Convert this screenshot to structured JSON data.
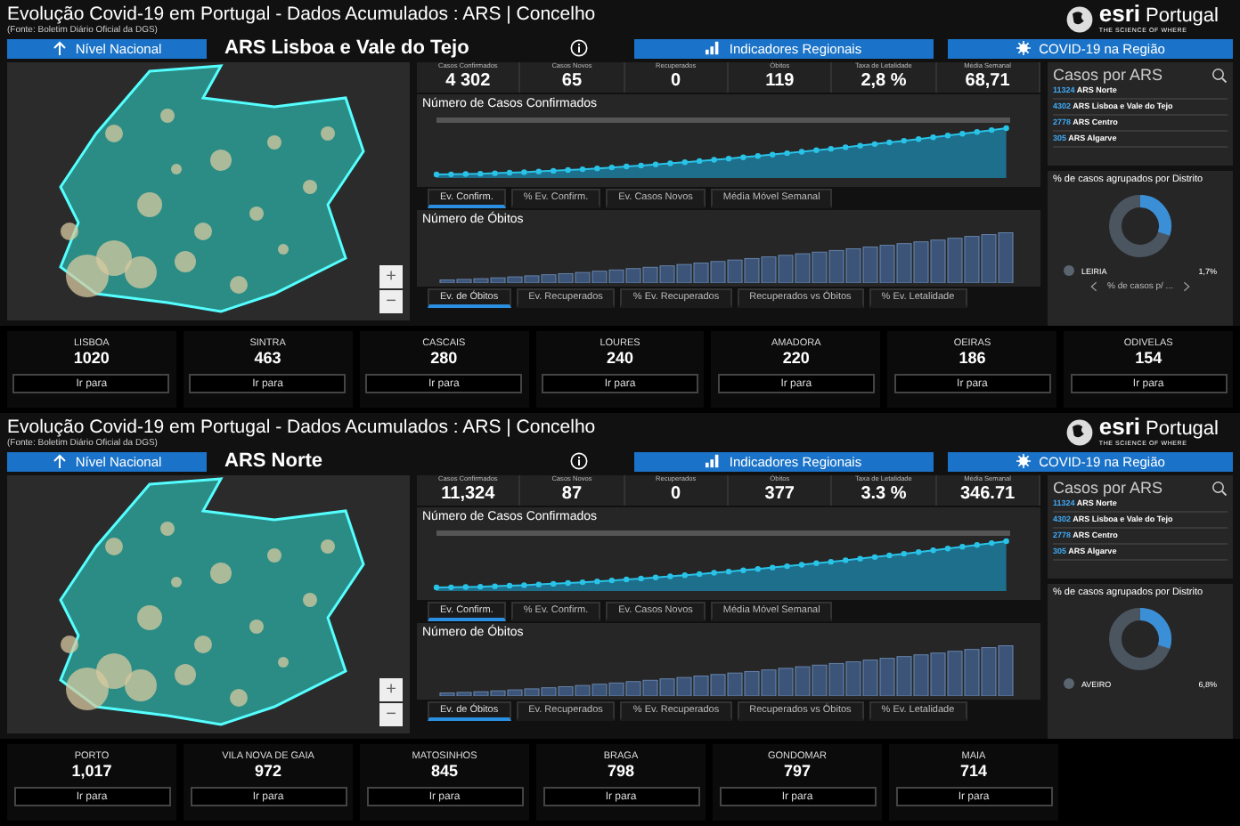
{
  "dashboards": [
    {
      "title": "Evolução Covid-19 em Portugal - Dados Acumulados : ARS | Concelho",
      "source": "(Fonte: Boletim Diário Oficial da DGS)",
      "nav_button": "Nível Nacional",
      "region": "ARS Lisboa e Vale do Tejo",
      "indicators_button": "Indicadores Regionais",
      "covid_button": "COVID-19 na Região",
      "logo": {
        "brand": "esri",
        "name": "Portugal",
        "tagline": "THE SCIENCE OF WHERE"
      },
      "zoom_controls": [
        "+",
        "−"
      ],
      "stats": [
        {
          "label": "Casos Confirmados",
          "value": "4 302"
        },
        {
          "label": "Casos Novos",
          "value": "65"
        },
        {
          "label": "Recuperados",
          "value": "0"
        },
        {
          "label": "Óbitos",
          "value": "119"
        },
        {
          "label": "Taxa de Letalidade",
          "value": "2,8 %"
        },
        {
          "label": "Média Semanal",
          "value": "68,71"
        }
      ],
      "cases_chart": {
        "title": "Número de Casos Confirmados",
        "tabs": [
          {
            "label": "Ev. Confirm.",
            "selected": true
          },
          {
            "label": "% Ev. Confirm.",
            "selected": false
          },
          {
            "label": "Ev. Casos Novos",
            "selected": false
          },
          {
            "label": "Média Móvel Semanal",
            "selected": false
          }
        ]
      },
      "deaths_chart": {
        "title": "Número de Óbitos",
        "tabs": [
          {
            "label": "Ev. de Óbitos",
            "selected": true
          },
          {
            "label": "Ev. Recuperados",
            "selected": false
          },
          {
            "label": "% Ev. Recuperados",
            "selected": false
          },
          {
            "label": "Recuperados vs Óbitos",
            "selected": false
          },
          {
            "label": "% Ev. Letalidade",
            "selected": false
          }
        ]
      },
      "ars_panel": {
        "title": "Casos por ARS",
        "items": [
          {
            "count": "11324",
            "name": "ARS Norte"
          },
          {
            "count": "4302",
            "name": "ARS Lisboa e Vale do Tejo"
          },
          {
            "count": "2778",
            "name": "ARS Centro"
          },
          {
            "count": "305",
            "name": "ARS Algarve"
          }
        ]
      },
      "district_panel": {
        "title": "% de casos agrupados por Distrito",
        "legend": [
          {
            "name": "LEIRIA",
            "value": "1,7%"
          }
        ],
        "pager": "% de casos p/ ..."
      },
      "municipalities": [
        {
          "name": "LISBOA",
          "count": "1020",
          "button": "Ir para"
        },
        {
          "name": "SINTRA",
          "count": "463",
          "button": "Ir para"
        },
        {
          "name": "CASCAIS",
          "count": "280",
          "button": "Ir para"
        },
        {
          "name": "LOURES",
          "count": "240",
          "button": "Ir para"
        },
        {
          "name": "AMADORA",
          "count": "220",
          "button": "Ir para"
        },
        {
          "name": "OEIRAS",
          "count": "186",
          "button": "Ir para"
        },
        {
          "name": "ODIVELAS",
          "count": "154",
          "button": "Ir para"
        }
      ]
    },
    {
      "title": "Evolução Covid-19 em Portugal - Dados Acumulados : ARS | Concelho",
      "source": "(Fonte: Boletim Diário Oficial da DGS)",
      "nav_button": "Nível Nacional",
      "region": "ARS Norte",
      "indicators_button": "Indicadores Regionais",
      "covid_button": "COVID-19 na Região",
      "logo": {
        "brand": "esri",
        "name": "Portugal",
        "tagline": "THE SCIENCE OF WHERE"
      },
      "zoom_controls": [
        "+",
        "−"
      ],
      "stats": [
        {
          "label": "Casos Confirmados",
          "value": "11,324"
        },
        {
          "label": "Casos Novos",
          "value": "87"
        },
        {
          "label": "Recuperados",
          "value": "0"
        },
        {
          "label": "Óbitos",
          "value": "377"
        },
        {
          "label": "Taxa de Letalidade",
          "value": "3.3 %"
        },
        {
          "label": "Média Semanal",
          "value": "346.71"
        }
      ],
      "cases_chart": {
        "title": "Número de Casos Confirmados",
        "tabs": [
          {
            "label": "Ev. Confirm.",
            "selected": true
          },
          {
            "label": "% Ev. Confirm.",
            "selected": false
          },
          {
            "label": "Ev. Casos Novos",
            "selected": false
          },
          {
            "label": "Média Móvel Semanal",
            "selected": false
          }
        ]
      },
      "deaths_chart": {
        "title": "Número de Óbitos",
        "tabs": [
          {
            "label": "Ev. de Óbitos",
            "selected": true
          },
          {
            "label": "Ev. Recuperados",
            "selected": false
          },
          {
            "label": "% Ev. Recuperados",
            "selected": false
          },
          {
            "label": "Recuperados vs Óbitos",
            "selected": false
          },
          {
            "label": "% Ev. Letalidade",
            "selected": false
          }
        ]
      },
      "ars_panel": {
        "title": "Casos por ARS",
        "items": [
          {
            "count": "11324",
            "name": "ARS Norte"
          },
          {
            "count": "4302",
            "name": "ARS Lisboa e Vale do Tejo"
          },
          {
            "count": "2778",
            "name": "ARS Centro"
          },
          {
            "count": "305",
            "name": "ARS Algarve"
          }
        ]
      },
      "district_panel": {
        "title": "% de casos agrupados por Distrito",
        "legend": [
          {
            "name": "AVEIRO",
            "value": "6,8%"
          }
        ]
      },
      "municipalities": [
        {
          "name": "PORTO",
          "count": "1,017",
          "button": "Ir para"
        },
        {
          "name": "VILA NOVA DE GAIA",
          "count": "972",
          "button": "Ir para"
        },
        {
          "name": "MATOSINHOS",
          "count": "845",
          "button": "Ir para"
        },
        {
          "name": "BRAGA",
          "count": "798",
          "button": "Ir para"
        },
        {
          "name": "GONDOMAR",
          "count": "797",
          "button": "Ir para"
        },
        {
          "name": "MAIA",
          "count": "714",
          "button": "Ir para"
        }
      ]
    }
  ]
}
